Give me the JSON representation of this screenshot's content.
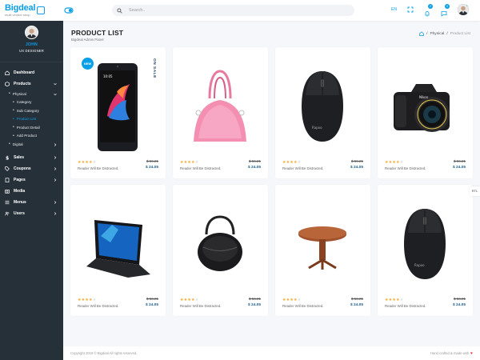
{
  "brand": {
    "name": "Bigdeal",
    "tagline": "multi vendor shop"
  },
  "search": {
    "placeholder": "Search.."
  },
  "header": {
    "language": "EN",
    "notifications_count": "2",
    "messages_count": "0"
  },
  "profile": {
    "name": "JOHN",
    "role": "UX DESIGNER"
  },
  "sidebar": {
    "dashboard": "Dashboard",
    "products": "Products",
    "physical": "Physical",
    "category": "Category",
    "sub_category": "Sub Category",
    "product_list": "Product List",
    "product_detail": "Product Detail",
    "add_product": "Add Product",
    "digital": "Digital",
    "sales": "Sales",
    "coupons": "Coupons",
    "pages": "Pages",
    "media": "Media",
    "menus": "Menus",
    "users": "Users"
  },
  "page": {
    "title": "PRODUCT LIST",
    "subtitle": "Bigdeal Admin Panel"
  },
  "breadcrumb": {
    "sep1": "/",
    "physical": "Physical",
    "sep2": "/",
    "current": "Product List"
  },
  "badges": {
    "new": "NEW",
    "sale": "ON SALE"
  },
  "products": [
    {
      "image": "smartphone",
      "rating": 4,
      "desc": "Reader Will Be Distracted.",
      "old_price": "$ 56.21",
      "price": "$ 24.05"
    },
    {
      "image": "pink-handbag",
      "rating": 4,
      "desc": "Reader Will Be Distracted.",
      "old_price": "$ 56.21",
      "price": "$ 24.05"
    },
    {
      "image": "computer-mouse",
      "rating": 4,
      "desc": "Reader Will Be Distracted.",
      "old_price": "$ 56.21",
      "price": "$ 24.05"
    },
    {
      "image": "dslr-camera",
      "rating": 4,
      "desc": "Reader Will Be Distracted.",
      "old_price": "$ 56.21",
      "price": "$ 24.05"
    },
    {
      "image": "laptop",
      "rating": 4,
      "desc": "Reader Will Be Distracted.",
      "old_price": "$ 56.21",
      "price": "$ 24.05"
    },
    {
      "image": "round-bag",
      "rating": 4,
      "desc": "Reader Will Be Distracted.",
      "old_price": "$ 56.21",
      "price": "$ 24.05"
    },
    {
      "image": "round-table",
      "rating": 4,
      "desc": "Reader Will Be Distracted.",
      "old_price": "$ 56.21",
      "price": "$ 24.05"
    },
    {
      "image": "computer-mouse",
      "rating": 4,
      "desc": "Reader Will Be Distracted.",
      "old_price": "$ 56.21",
      "price": "$ 24.05"
    }
  ],
  "rtl_label": "RTL",
  "footer": {
    "copyright": "Copyright 2019 © Bigdeal All rights reserved.",
    "credit": "Hand crafted & made with"
  },
  "colors": {
    "accent": "#0a9fe6",
    "sidebar_bg": "#263039",
    "star": "#f5a623",
    "price": "#1b5e8a"
  }
}
